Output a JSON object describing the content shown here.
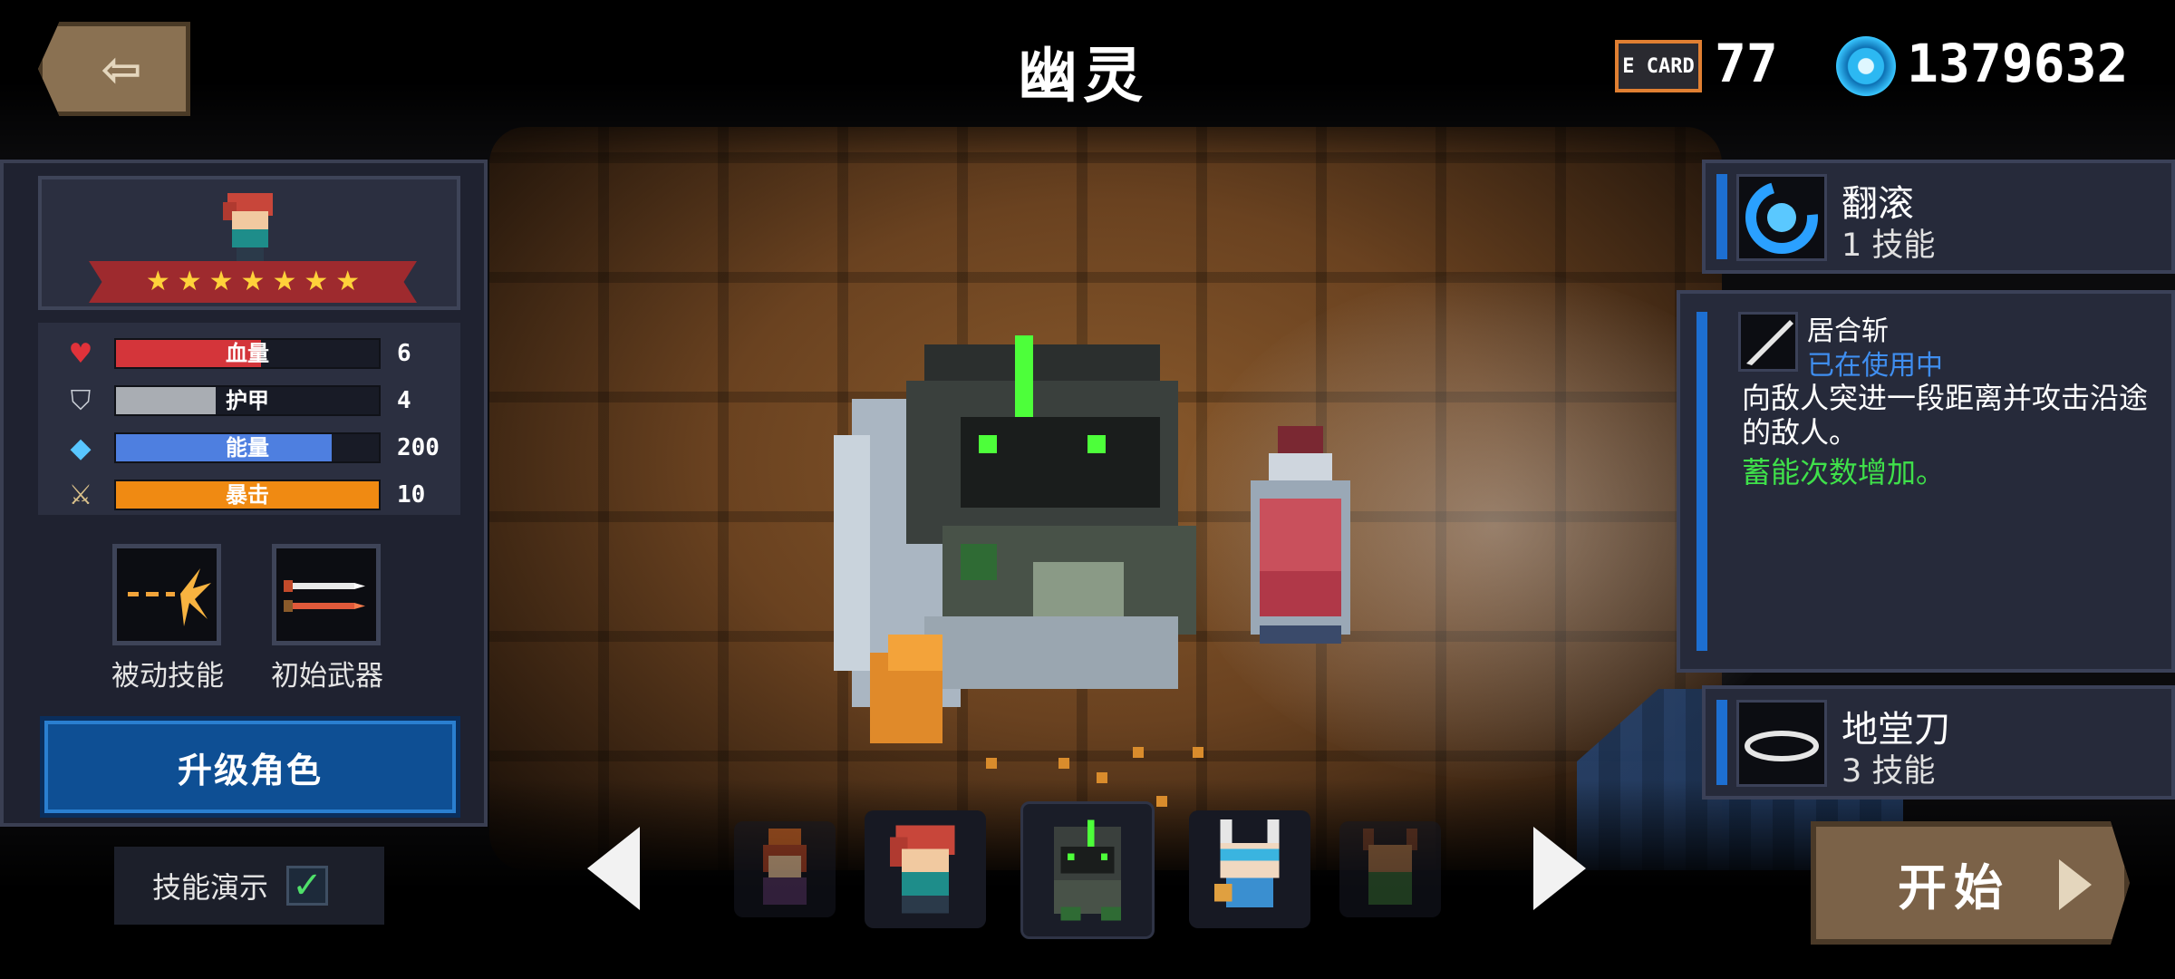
{
  "header": {
    "title": "幽灵",
    "energy_card_label": "E CARD",
    "energy_count": "77",
    "gem_count": "1379632"
  },
  "left_panel": {
    "stars": 7,
    "stats": [
      {
        "label": "血量",
        "value": "6",
        "fill": 0.55,
        "color": "#d4353a",
        "icon": "heart-icon"
      },
      {
        "label": "护甲",
        "value": "4",
        "fill": 0.38,
        "color": "#a9adb3",
        "icon": "shield-icon"
      },
      {
        "label": "能量",
        "value": "200",
        "fill": 0.82,
        "color": "#4e7fe0",
        "icon": "energy-crystal-icon"
      },
      {
        "label": "暴击",
        "value": "10",
        "fill": 1.0,
        "color": "#f08a12",
        "icon": "dagger-icon"
      }
    ],
    "passive_skill_label": "被动技能",
    "start_weapon_label": "初始武器",
    "upgrade_button": "升级角色",
    "skill_demo_label": "技能演示",
    "skill_demo_checked": true
  },
  "skills": {
    "top": {
      "name": "翻滚",
      "sub": "1 技能"
    },
    "detail": {
      "name": "居合斩",
      "status": "已在使用中",
      "description": "向敌人突进一段距离并攻击沿途的敌人。",
      "bonus": "蓄能次数增加。"
    },
    "bottom": {
      "name": "地堂刀",
      "sub": "3 技能"
    }
  },
  "start_button": "开始",
  "carousel": {
    "selected_index": 2,
    "count": 5
  }
}
